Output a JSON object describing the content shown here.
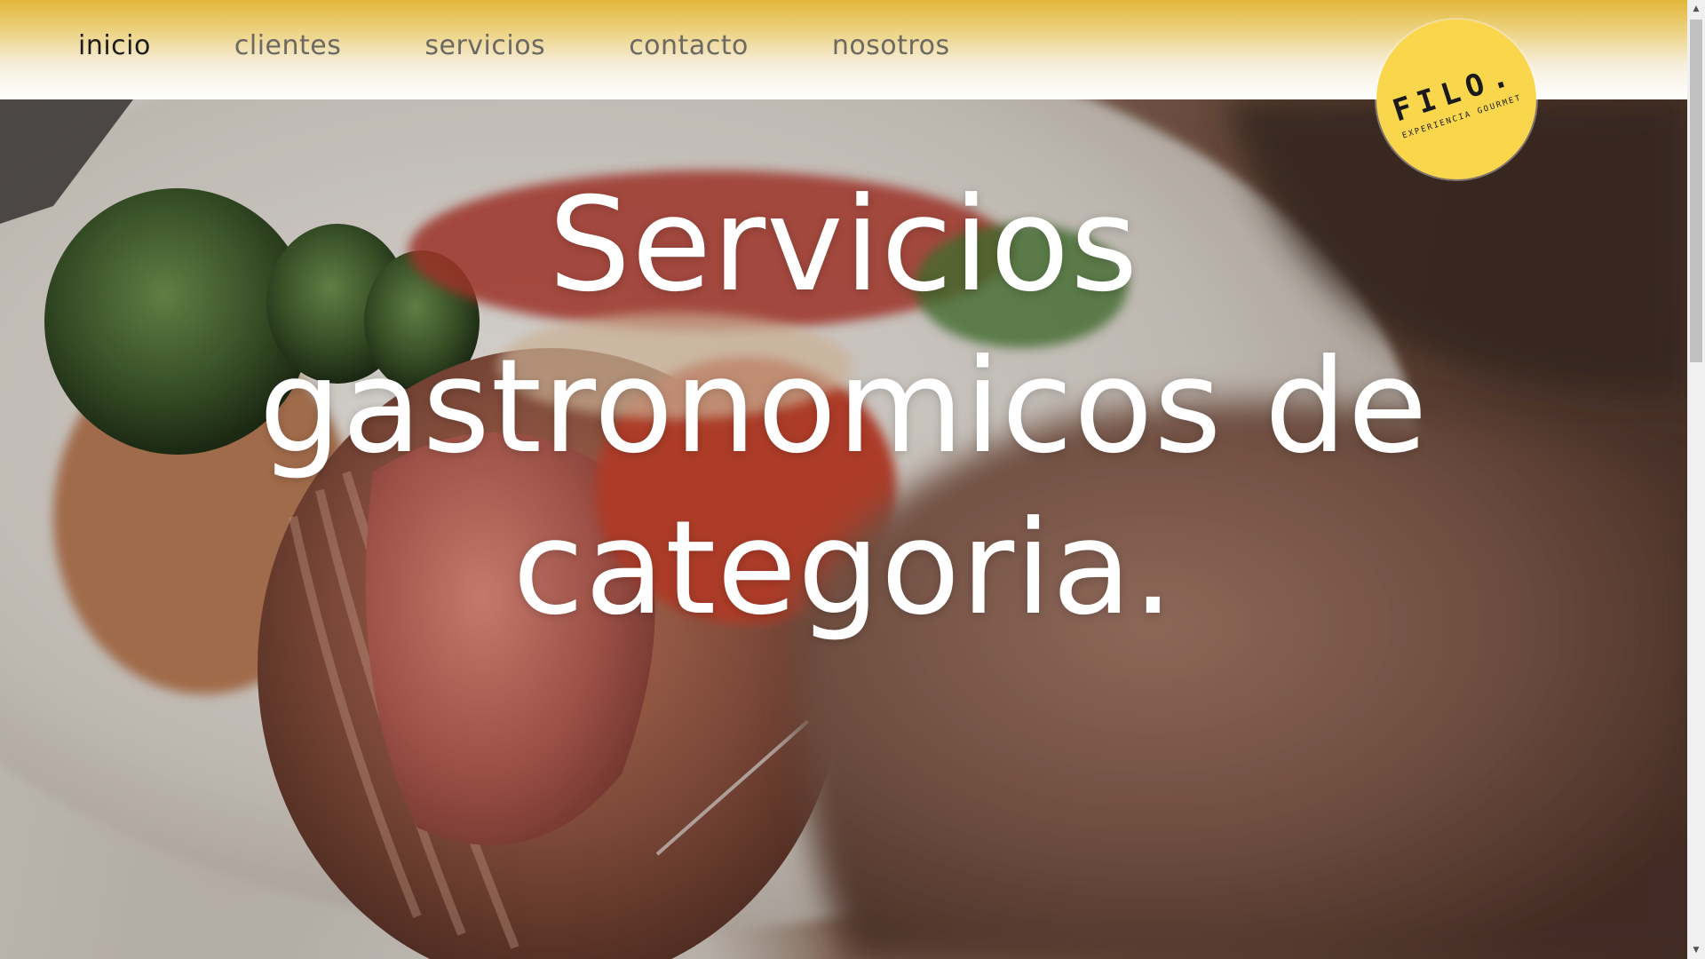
{
  "nav": {
    "items": [
      {
        "label": "inicio",
        "active": true
      },
      {
        "label": "clientes",
        "active": false
      },
      {
        "label": "servicios",
        "active": false
      },
      {
        "label": "contacto",
        "active": false
      },
      {
        "label": "nosotros",
        "active": false
      }
    ]
  },
  "logo": {
    "title": "FILO.",
    "subtitle": "EXPERIENCIA GOURMET",
    "color": "#f9d64b"
  },
  "hero": {
    "headline_line1": "Servicios",
    "headline_line2": "gastronomicos de",
    "headline_line3": "categoria.",
    "background": "food-photo-scallop-dish"
  },
  "colors": {
    "nav_gradient_top": "#e3b73a",
    "nav_active_text": "#1c1c1c",
    "nav_text": "#6c6963",
    "headline_text": "#ffffff"
  },
  "scrollbar": {
    "up_icon": "scroll-up-arrow",
    "down_icon": "scroll-down-arrow"
  }
}
